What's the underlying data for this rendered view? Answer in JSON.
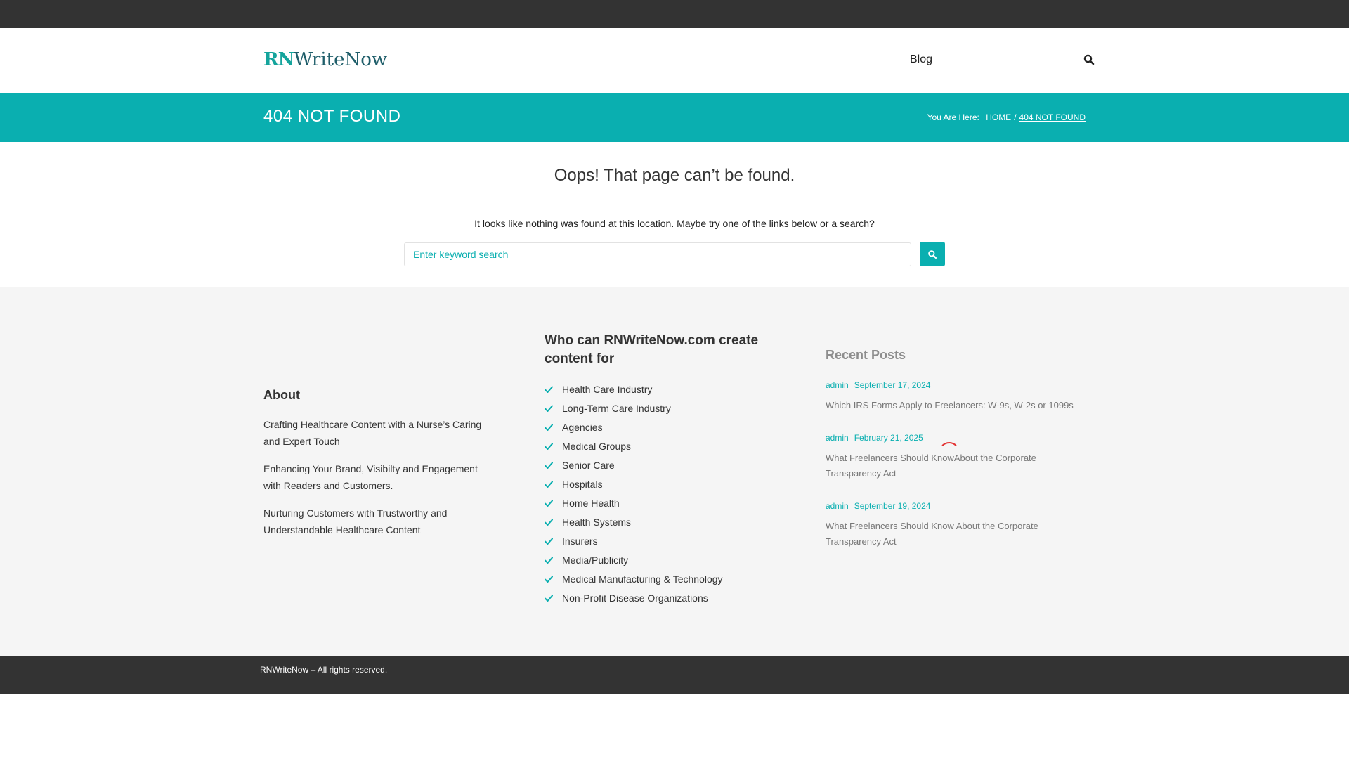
{
  "header": {
    "logo_rn": "RN",
    "logo_rest": "WriteNow",
    "nav_blog": "Blog"
  },
  "banner": {
    "title": "404 NOT FOUND",
    "breadcrumb_label": "You Are Here:",
    "breadcrumb_home": "HOME",
    "breadcrumb_separator": "/",
    "breadcrumb_current": "404 NOT FOUND"
  },
  "content": {
    "heading": "Oops! That page can’t be found.",
    "message": "It looks like nothing was found at this location. Maybe try one of the links below or a search?",
    "search_placeholder": "Enter keyword search",
    "search_value": ""
  },
  "footer": {
    "about": {
      "title": "About",
      "paragraphs": [
        "Crafting Healthcare Content with a Nurse’s Caring and Expert Touch",
        "Enhancing Your Brand, Visibilty and Engagement with Readers and Customers.",
        "Nurturing Customers with Trustworthy and Understandable Healthcare Content"
      ]
    },
    "who": {
      "title": "Who can RNWriteNow.com create content for",
      "items": [
        "Health Care Industry",
        "Long-Term Care Industry",
        "Agencies",
        "Medical Groups",
        "Senior Care",
        "Hospitals",
        "Home Health",
        "Health Systems",
        "Insurers",
        "Media/Publicity",
        "Medical Manufacturing & Technology",
        "Non-Profit Disease Organizations"
      ]
    },
    "recent": {
      "title": "Recent Posts",
      "posts": [
        {
          "author": "admin",
          "date": "September 17, 2024",
          "title": "Which IRS Forms Apply to Freelancers:  W-9s, W-2s or 1099s"
        },
        {
          "author": "admin",
          "date": "February 21, 2025",
          "title": "What Freelancers Should KnowAbout the Corporate Transparency Act"
        },
        {
          "author": "admin",
          "date": "September 19, 2024",
          "title": "What Freelancers Should Know About the Corporate Transparency Act"
        }
      ]
    }
  },
  "bottom": {
    "copyright": "RNWriteNow –  All rights reserved."
  },
  "colors": {
    "accent": "#0aafb0",
    "topbar": "#333333",
    "footer_bg": "#f5f5f5",
    "spinner": "#e33333"
  },
  "icons": {
    "search": "search-icon",
    "check": "check-icon",
    "loading": "loading-spinner-icon"
  }
}
